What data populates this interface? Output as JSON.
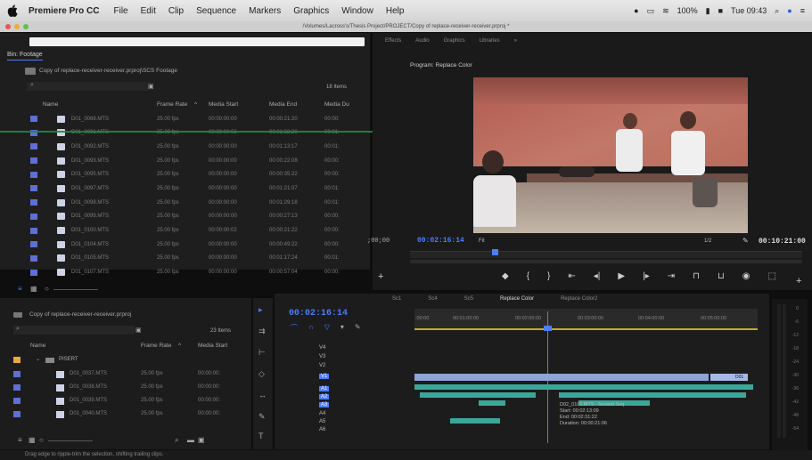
{
  "menubar": {
    "items": [
      "Premiere Pro CC",
      "File",
      "Edit",
      "Clip",
      "Sequence",
      "Markers",
      "Graphics",
      "Window",
      "Help"
    ],
    "battery": "100%",
    "clock": "Tue 09:43"
  },
  "window": {
    "title": "/Volumes/Lacross's/Thesis Project/PROJECT/Copy of replace-receiver-receiver.prproj *"
  },
  "workspace_tabs": [
    "Effects",
    "Audio",
    "Graphics",
    "Libraries",
    "»"
  ],
  "bin": {
    "title": "Bin: Footage",
    "path": "Copy of replace-receiver-receiver.prproj\\SCS Footage",
    "item_count": "18 Items",
    "columns": [
      "Name",
      "Frame Rate",
      "Media Start",
      "Media End",
      "Media Du"
    ],
    "rows": [
      {
        "name": "D01_0088.MTS",
        "fps": "25.00 fps",
        "start": "00:00:00:00",
        "end": "00:00:21:20",
        "dur": "00:00:"
      },
      {
        "name": "D01_0091.MTS",
        "fps": "25.00 fps",
        "start": "00:00:00:02",
        "end": "00:01:32:20",
        "dur": "00:01:"
      },
      {
        "name": "D01_0092.MTS",
        "fps": "25.00 fps",
        "start": "00:00:00:00",
        "end": "00:01:13:17",
        "dur": "00:01:"
      },
      {
        "name": "D01_0093.MTS",
        "fps": "25.00 fps",
        "start": "00:00:00:00",
        "end": "00:00:22:08",
        "dur": "00:00:"
      },
      {
        "name": "D01_0095.MTS",
        "fps": "25.00 fps",
        "start": "00:00:00:00",
        "end": "00:00:35:22",
        "dur": "00:00:"
      },
      {
        "name": "D01_0097.MTS",
        "fps": "25.00 fps",
        "start": "00:00:00:00",
        "end": "00:01:21:07",
        "dur": "00:01:"
      },
      {
        "name": "D01_0098.MTS",
        "fps": "25.00 fps",
        "start": "00:00:00:00",
        "end": "00:01:29:18",
        "dur": "00:01:"
      },
      {
        "name": "D01_0099.MTS",
        "fps": "25.00 fps",
        "start": "00:00:00:00",
        "end": "00:00:27:13",
        "dur": "00:00:"
      },
      {
        "name": "D01_0100.MTS",
        "fps": "25.00 fps",
        "start": "00:00:00:02",
        "end": "00:00:21:22",
        "dur": "00:00:"
      },
      {
        "name": "D01_0104.MTS",
        "fps": "25.00 fps",
        "start": "00:00:00:00",
        "end": "00:00:49:22",
        "dur": "00:00:"
      },
      {
        "name": "D01_0105.MTS",
        "fps": "25.00 fps",
        "start": "00:00:00:00",
        "end": "00:01:17:24",
        "dur": "00:01:"
      },
      {
        "name": "D01_0107.MTS",
        "fps": "25.00 fps",
        "start": "00:00:00:00",
        "end": "00:00:57:04",
        "dur": "00:00:"
      }
    ]
  },
  "program": {
    "title": "Program: Replace Color",
    "left_tc": ";00;00",
    "timecode": "00:02:16:14",
    "fit": "Fit",
    "resolution": "1/2",
    "duration": "00:10:21:00"
  },
  "project2": {
    "title": "Copy of replace-receiver-receiver.prproj",
    "item_count": "23 Items",
    "columns": [
      "Name",
      "Frame Rate",
      "Media Start"
    ],
    "folder": "PISERT",
    "rows": [
      {
        "name": "D01_0037.MTS",
        "fps": "25.00 fps",
        "start": "00:00:00:"
      },
      {
        "name": "D01_0038.MTS",
        "fps": "25.00 fps",
        "start": "00:00:00:"
      },
      {
        "name": "D01_0039.MTS",
        "fps": "25.00 fps",
        "start": "00:00:00:"
      },
      {
        "name": "D01_0040.MTS",
        "fps": "25.00 fps",
        "start": "00:00:00:"
      }
    ]
  },
  "timeline": {
    "tabs": [
      "Sc1",
      "Sc4",
      "Sc5",
      "Replace Color",
      "Replace Color2"
    ],
    "timecode": "00:02:16:14",
    "ruler": [
      ":00:00",
      "00:01:00:00",
      "00:02:00:00",
      "00:03:00:00",
      "00:04:00:00",
      "00:05:00:00"
    ],
    "video_tracks": [
      "V4",
      "V3",
      "V2",
      "V1"
    ],
    "audio_tracks": [
      "A1",
      "A2",
      "A3",
      "A4",
      "A5",
      "A6"
    ],
    "tooltip": {
      "line1": "D02_0101.MTS - Nested Seq",
      "line2": "Start: 00:02:13:09",
      "line3": "End: 00:02:31:22",
      "line4": "Duration: 00:00:21:06"
    },
    "clip_label": "D01"
  },
  "meter_ticks": [
    "0",
    "-6",
    "-12",
    "-18",
    "-24",
    "-30",
    "-36",
    "-42",
    "-48",
    "-54"
  ],
  "status": "Drag edge to ripple-trim the selection, shifting trailing clips.",
  "colors": {
    "accent": "#4d7dff",
    "label_violet": "#5f6fd6",
    "audio": "#3aa79a",
    "folder_orange": "#e8a93a"
  }
}
